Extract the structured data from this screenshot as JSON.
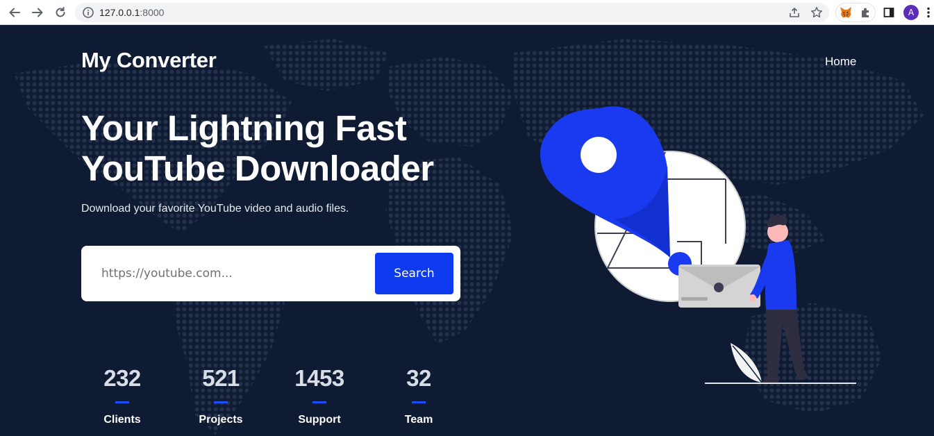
{
  "browser": {
    "url_host": "127.0.0.1",
    "url_port": ":8000",
    "avatar_letter": "A",
    "icons": {
      "back": "back-arrow-icon",
      "forward": "forward-arrow-icon",
      "reload": "reload-icon",
      "site_info": "info-icon",
      "share": "share-icon",
      "bookmark": "star-icon",
      "metamask": "fox-extension-icon",
      "extensions": "puzzle-icon",
      "side_panel": "side-panel-icon",
      "menu": "kebab-menu-icon"
    }
  },
  "header": {
    "brand": "My Converter",
    "nav": [
      "Home"
    ]
  },
  "hero": {
    "title_line1": "Your Lightning Fast",
    "title_line2": "YouTube Downloader",
    "subtitle": "Download your favorite YouTube video and audio files."
  },
  "search": {
    "placeholder": "https://youtube.com...",
    "value": "",
    "button_label": "Search"
  },
  "stats": [
    {
      "value": "232",
      "label": "Clients"
    },
    {
      "value": "521",
      "label": "Projects"
    },
    {
      "value": "1453",
      "label": "Support"
    },
    {
      "value": "32",
      "label": "Team"
    }
  ],
  "colors": {
    "background": "#0f1b33",
    "accent": "#0f3bf0",
    "white": "#ffffff",
    "stat_number": "#d9dde6"
  }
}
